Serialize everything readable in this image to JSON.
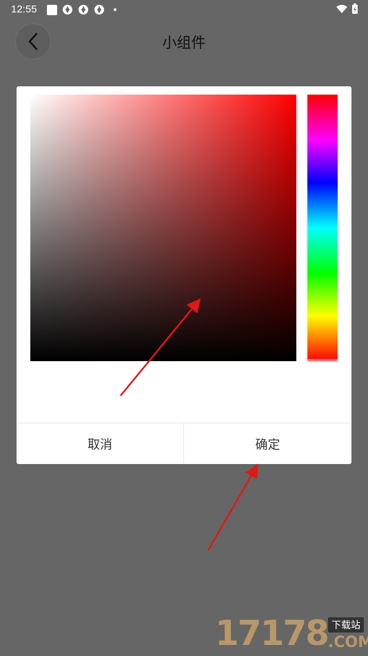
{
  "status_bar": {
    "time": "12:55"
  },
  "header": {
    "title": "小组件"
  },
  "color_picker": {
    "base_hue": "#ff0000",
    "selected_hue_fraction": 0.0
  },
  "dialog": {
    "cancel_label": "取消",
    "confirm_label": "确定"
  },
  "colors": {
    "background": "#666666",
    "dialog": "#ffffff",
    "arrow": "#e01818"
  },
  "watermark": {
    "number": "17178",
    "tag": "下载站",
    "suffix": ".COM"
  }
}
